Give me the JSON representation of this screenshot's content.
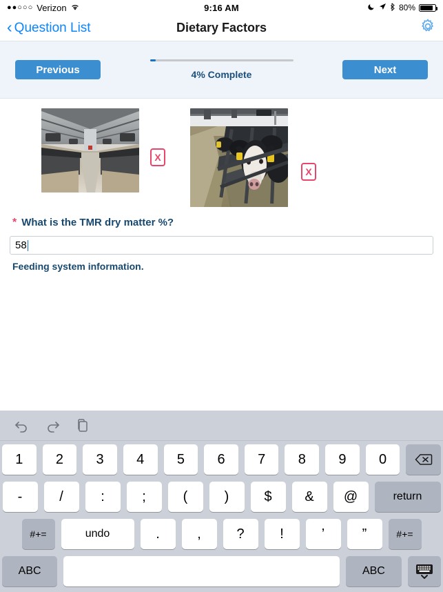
{
  "status_bar": {
    "signal_dots": "●●○○○",
    "carrier": "Verizon",
    "wifi_icon": "wifi-icon",
    "time": "9:16 AM",
    "moon_icon": "moon-icon",
    "location_icon": "location-arrow-icon",
    "bluetooth_icon": "bluetooth-icon",
    "battery_percent": "80%"
  },
  "nav_bar": {
    "back_chevron": "‹",
    "back_label": "Question List",
    "title": "Dietary Factors",
    "gear_icon": "gear-icon"
  },
  "toolbar": {
    "previous_label": "Previous",
    "next_label": "Next",
    "progress_percent": 4,
    "progress_label": "4% Complete"
  },
  "photos": [
    {
      "alt": "barn-interior-feed-alley",
      "delete_label": "X"
    },
    {
      "alt": "holstein-cows-at-feed-bunk",
      "delete_label": "X"
    }
  ],
  "question": {
    "required_marker": "*",
    "text": "What is the TMR dry matter %?",
    "answer_value": "58",
    "answer_placeholder": "",
    "helper_text": "Feeding system information."
  },
  "keyboard": {
    "toolbar": {
      "undo_icon": "undo-icon",
      "redo_icon": "redo-icon",
      "paste_icon": "paste-icon"
    },
    "row1": [
      "1",
      "2",
      "3",
      "4",
      "5",
      "6",
      "7",
      "8",
      "9",
      "0"
    ],
    "backspace_label": "⌫",
    "row2": [
      "-",
      "/",
      ":",
      ";",
      "(",
      ")",
      "$",
      "&",
      "@"
    ],
    "return_label": "return",
    "row3_left_label": "#+=",
    "undo_label": "undo",
    "row3": [
      ".",
      ",",
      "?",
      "!",
      "’",
      "”"
    ],
    "row3_right_label": "#+=",
    "abc_left_label": "ABC",
    "space_label": "",
    "abc_right_label": "ABC",
    "hide_keyboard_icon": "hide-keyboard-icon"
  },
  "colors": {
    "accent_blue": "#3b8ed0",
    "ios_blue": "#0b84ff",
    "label_navy": "#17486f",
    "required_red": "#e8456b",
    "toolbar_bg": "#eef4fa",
    "keyboard_bg": "#ccd0d8"
  }
}
